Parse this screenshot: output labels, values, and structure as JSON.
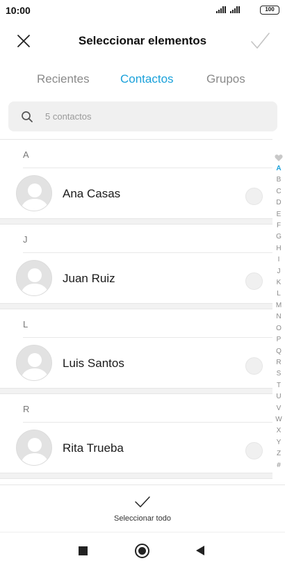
{
  "status_bar": {
    "time": "10:00",
    "battery": "100"
  },
  "header": {
    "title": "Seleccionar elementos",
    "close_icon": "close-icon",
    "confirm_icon": "check-icon"
  },
  "tabs": [
    {
      "label": "Recientes",
      "active": false
    },
    {
      "label": "Contactos",
      "active": true
    },
    {
      "label": "Grupos",
      "active": false
    }
  ],
  "search": {
    "placeholder": "5 contactos",
    "icon": "search-icon"
  },
  "groups": [
    {
      "letter": "A",
      "contacts": [
        {
          "name": "Ana Casas",
          "selected": false
        }
      ]
    },
    {
      "letter": "J",
      "contacts": [
        {
          "name": "Juan Ruiz",
          "selected": false
        }
      ]
    },
    {
      "letter": "L",
      "contacts": [
        {
          "name": "Luis Santos",
          "selected": false
        }
      ]
    },
    {
      "letter": "R",
      "contacts": [
        {
          "name": "Rita Trueba",
          "selected": false
        }
      ]
    }
  ],
  "index_bar": {
    "favorite_icon": "heart-icon",
    "letters": [
      "A",
      "B",
      "C",
      "D",
      "E",
      "F",
      "G",
      "H",
      "I",
      "J",
      "K",
      "L",
      "M",
      "N",
      "O",
      "P",
      "Q",
      "R",
      "S",
      "T",
      "U",
      "V",
      "W",
      "X",
      "Y",
      "Z",
      "#"
    ],
    "active": "A"
  },
  "select_all": {
    "label": "Seleccionar todo",
    "icon": "check-icon"
  },
  "navbar": {
    "recents_icon": "square-icon",
    "home_icon": "home-circle-icon",
    "back_icon": "back-triangle-icon"
  },
  "colors": {
    "accent": "#1aa1da",
    "text_primary": "#1a1a1a",
    "text_secondary": "#8a8a8a",
    "search_bg": "#f0f0f0"
  }
}
